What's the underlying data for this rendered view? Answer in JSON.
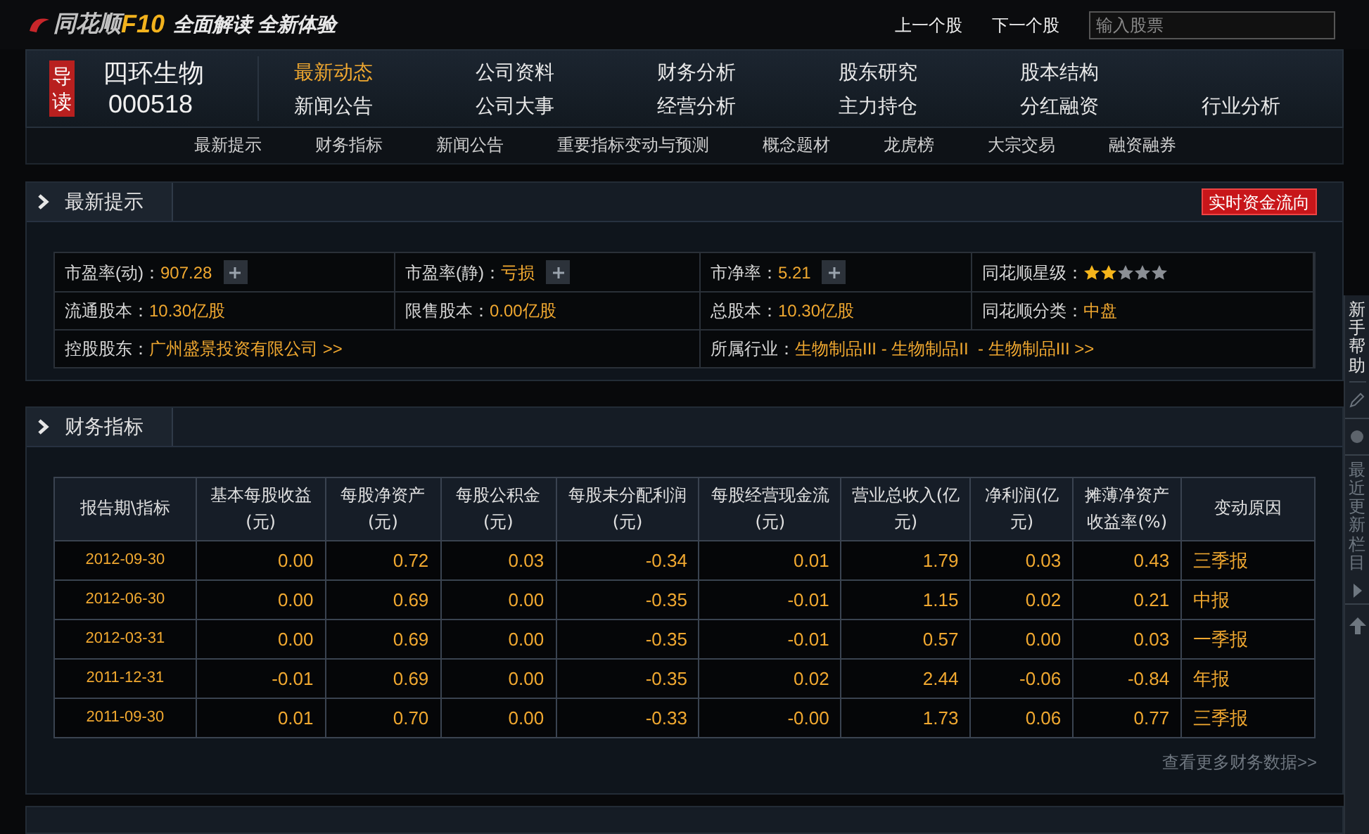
{
  "brand": {
    "name": "同花顺",
    "product": "F10",
    "slogan": "全面解读 全新体验"
  },
  "top_links": [
    "上一个股",
    "下一个股"
  ],
  "search": {
    "placeholder": "输入股票"
  },
  "stock": {
    "badge": "导读",
    "name": "四环生物",
    "code": "000518"
  },
  "nav": [
    {
      "label": "最新动态",
      "selected": true
    },
    {
      "label": "公司资料",
      "selected": false
    },
    {
      "label": "财务分析",
      "selected": false
    },
    {
      "label": "股东研究",
      "selected": false
    },
    {
      "label": "股本结构",
      "selected": false
    },
    {
      "label": "新闻公告",
      "selected": false
    },
    {
      "label": "公司大事",
      "selected": false
    },
    {
      "label": "经营分析",
      "selected": false
    },
    {
      "label": "主力持仓",
      "selected": false
    },
    {
      "label": "分红融资",
      "selected": false
    },
    {
      "label": "行业分析",
      "selected": false
    }
  ],
  "subnav": [
    "最新提示",
    "财务指标",
    "新闻公告",
    "重要指标变动与预测",
    "概念题材",
    "龙虎榜",
    "大宗交易",
    "融资融券"
  ],
  "summary": {
    "title": "最新提示",
    "action": "实时资金流向",
    "rows": [
      [
        {
          "label": "市盈率(动)：",
          "value": "907.28",
          "kind": "plus"
        },
        {
          "label": "市盈率(静)：",
          "value": "亏损",
          "kind": "plus"
        },
        {
          "label": "市净率：",
          "value": "5.21",
          "kind": "plus"
        },
        {
          "label": "同花顺星级：",
          "stars": 2,
          "kind": "stars"
        }
      ],
      [
        {
          "label": "流通股本：",
          "value": "10.30亿股",
          "kind": "text"
        },
        {
          "label": "限售股本：",
          "value": "0.00亿股",
          "kind": "text"
        },
        {
          "label": "总股本：",
          "value": "10.30亿股",
          "kind": "text"
        },
        {
          "label": "同花顺分类：",
          "value": "中盘",
          "kind": "text"
        }
      ]
    ],
    "links": [
      {
        "label": "控股股东：",
        "value": "广州盛景投资有限公司 >>"
      },
      {
        "label": "所属行业：",
        "value": "生物制品III - 生物制品II  - 生物制品III >>"
      }
    ]
  },
  "finance": {
    "title": "财务指标",
    "columns": [
      "报告期\\指标",
      "基本每股收益(元)",
      "每股净资产(元)",
      "每股公积金(元)",
      "每股未分配利润(元)",
      "每股经营现金流(元)",
      "营业总收入(亿元)",
      "净利润(亿元)",
      "摊薄净资产收益率(%)",
      "变动原因"
    ],
    "rows": [
      [
        "2012-09-30",
        "0.00",
        "0.72",
        "0.03",
        "-0.34",
        "0.01",
        "1.79",
        "0.03",
        "0.43",
        "三季报"
      ],
      [
        "2012-06-30",
        "0.00",
        "0.69",
        "0.00",
        "-0.35",
        "-0.01",
        "1.15",
        "0.02",
        "0.21",
        "中报"
      ],
      [
        "2012-03-31",
        "0.00",
        "0.69",
        "0.00",
        "-0.35",
        "-0.01",
        "0.57",
        "0.00",
        "0.03",
        "一季报"
      ],
      [
        "2011-12-31",
        "-0.01",
        "0.69",
        "0.00",
        "-0.35",
        "0.02",
        "2.44",
        "-0.06",
        "-0.84",
        "年报"
      ],
      [
        "2011-09-30",
        "0.01",
        "0.70",
        "0.00",
        "-0.33",
        "-0.00",
        "1.73",
        "0.06",
        "0.77",
        "三季报"
      ]
    ],
    "more": "查看更多财务数据>>"
  },
  "side": [
    {
      "kind": "text",
      "label": "新手帮助"
    },
    {
      "kind": "pencil"
    },
    {
      "kind": "dot"
    },
    {
      "kind": "text-arrow",
      "label": "最近更新栏目"
    },
    {
      "kind": "up"
    }
  ]
}
